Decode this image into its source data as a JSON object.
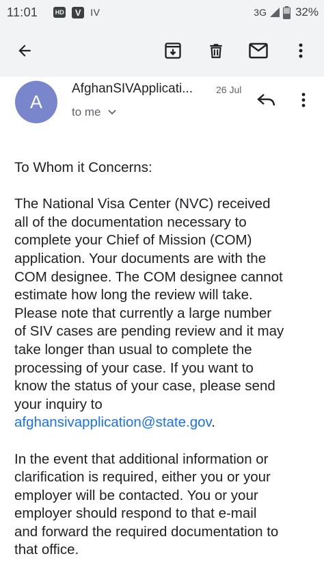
{
  "status_bar": {
    "time": "11:01",
    "hd_badge": "HD",
    "v_badge": "V",
    "iv_text": "IV",
    "network": "3G",
    "battery": "32%"
  },
  "toolbar": {
    "icons": [
      "back-arrow-icon",
      "archive-icon",
      "delete-icon",
      "mark-unread-icon",
      "more-vert-icon"
    ]
  },
  "message": {
    "avatar_letter": "A",
    "avatar_color": "#7986cb",
    "sender": "AfghanSIVApplicati...",
    "date": "26 Jul",
    "recipient": "to me"
  },
  "body": {
    "greeting": "To Whom it Concerns:",
    "paragraph1_lines": [
      "The National Visa Center (NVC) received",
      "all of the documentation necessary to",
      "complete your Chief of Mission (COM)",
      "application. Your documents are with the",
      "COM designee. The COM designee cannot",
      "estimate how long the review will take.",
      "Please note that currently a large number",
      "of SIV cases are pending review and it may",
      "take longer than usual to complete the",
      "processing of your case. If you want to",
      "know the status of your case, please send",
      "your inquiry to"
    ],
    "email_link": "afghansivapplication@state.gov",
    "link_trailing": ".",
    "paragraph2_lines": [
      "In the event that additional information or",
      "clarification is required, either you or your",
      "employer will be contacted. You or your",
      "employer should respond to that e-mail",
      "and forward the required documentation to",
      "that office."
    ]
  },
  "colors": {
    "toolbar_bg": "#f1f3f4",
    "link": "#1a73e8",
    "text": "#202124",
    "secondary_text": "#5f6368"
  }
}
